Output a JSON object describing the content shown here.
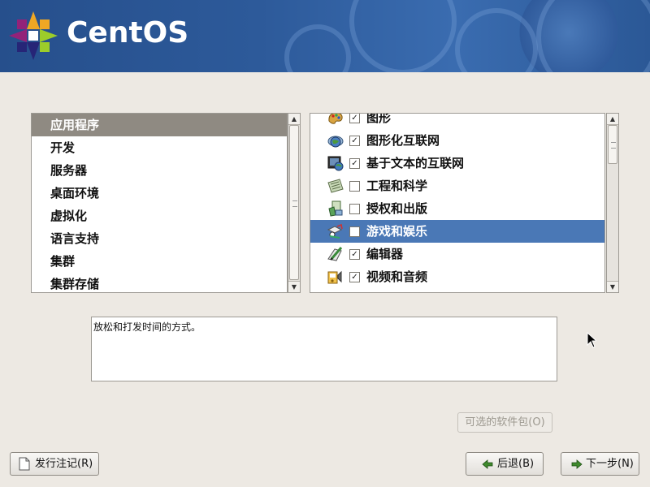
{
  "banner": {
    "logo_text": "CentOS"
  },
  "categories": [
    {
      "label": "应用程序"
    },
    {
      "label": "开发"
    },
    {
      "label": "服务器"
    },
    {
      "label": "桌面环境"
    },
    {
      "label": "虚拟化"
    },
    {
      "label": "语言支持"
    },
    {
      "label": "集群"
    },
    {
      "label": "集群存储"
    }
  ],
  "packages": [
    {
      "label": "图形",
      "checked": true,
      "icon": "graphics-palette-icon"
    },
    {
      "label": "图形化互联网",
      "checked": true,
      "icon": "globe-internet-icon"
    },
    {
      "label": "基于文本的互联网",
      "checked": true,
      "icon": "terminal-globe-icon"
    },
    {
      "label": "工程和科学",
      "checked": false,
      "icon": "calculator-icon"
    },
    {
      "label": "授权和出版",
      "checked": false,
      "icon": "publishing-icon"
    },
    {
      "label": "游戏和娱乐",
      "checked": false,
      "icon": "games-icon"
    },
    {
      "label": "编辑器",
      "checked": true,
      "icon": "editor-pen-icon"
    },
    {
      "label": "视频和音频",
      "checked": true,
      "icon": "multimedia-icon"
    }
  ],
  "description": "放松和打发时间的方式。",
  "buttons": {
    "optional": "可选的软件包(O)",
    "release_notes": "发行注记(R)",
    "back": "后退(B)",
    "next": "下一步(N)"
  },
  "colors": {
    "banner": "#2d5a9a",
    "left_selected": "#8f8a82",
    "right_selected": "#4a78b6"
  }
}
